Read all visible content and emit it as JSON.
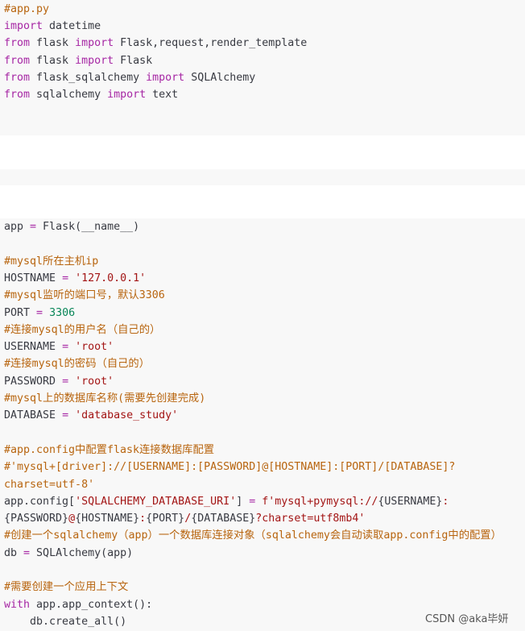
{
  "block1": {
    "lines": [
      {
        "segs": [
          {
            "t": "#app.py",
            "c": "cm"
          }
        ]
      },
      {
        "segs": [
          {
            "t": "import",
            "c": "kw"
          },
          {
            "t": " datetime",
            "c": ""
          }
        ]
      },
      {
        "segs": [
          {
            "t": "from",
            "c": "kw"
          },
          {
            "t": " flask ",
            "c": ""
          },
          {
            "t": "import",
            "c": "kw"
          },
          {
            "t": " Flask,request,render_template",
            "c": ""
          }
        ]
      },
      {
        "segs": [
          {
            "t": "from",
            "c": "kw"
          },
          {
            "t": " flask ",
            "c": ""
          },
          {
            "t": "import",
            "c": "kw"
          },
          {
            "t": " Flask",
            "c": ""
          }
        ]
      },
      {
        "segs": [
          {
            "t": "from",
            "c": "kw"
          },
          {
            "t": " flask_sqlalchemy ",
            "c": ""
          },
          {
            "t": "import",
            "c": "kw"
          },
          {
            "t": " SQLAlchemy",
            "c": ""
          }
        ]
      },
      {
        "segs": [
          {
            "t": "from",
            "c": "kw"
          },
          {
            "t": " sqlalchemy ",
            "c": ""
          },
          {
            "t": "import",
            "c": "kw"
          },
          {
            "t": " text",
            "c": ""
          }
        ]
      }
    ]
  },
  "block2": {
    "lines": [
      {
        "segs": [
          {
            "t": "app ",
            "c": ""
          },
          {
            "t": "=",
            "c": "op"
          },
          {
            "t": " Flask(__name__)",
            "c": ""
          }
        ]
      },
      {
        "segs": []
      },
      {
        "segs": [
          {
            "t": "#mysql所在主机ip",
            "c": "cm"
          }
        ]
      },
      {
        "segs": [
          {
            "t": "HOSTNAME ",
            "c": ""
          },
          {
            "t": "=",
            "c": "op"
          },
          {
            "t": " ",
            "c": ""
          },
          {
            "t": "'127.0.0.1'",
            "c": "st"
          }
        ]
      },
      {
        "segs": [
          {
            "t": "#mysql监听的端口号，默认3306",
            "c": "cm"
          }
        ]
      },
      {
        "segs": [
          {
            "t": "PORT ",
            "c": ""
          },
          {
            "t": "=",
            "c": "op"
          },
          {
            "t": " ",
            "c": ""
          },
          {
            "t": "3306",
            "c": "nm"
          }
        ]
      },
      {
        "segs": [
          {
            "t": "#连接mysql的用户名（自己的）",
            "c": "cm"
          }
        ]
      },
      {
        "segs": [
          {
            "t": "USERNAME ",
            "c": ""
          },
          {
            "t": "=",
            "c": "op"
          },
          {
            "t": " ",
            "c": ""
          },
          {
            "t": "'root'",
            "c": "st"
          }
        ]
      },
      {
        "segs": [
          {
            "t": "#连接mysql的密码（自己的）",
            "c": "cm"
          }
        ]
      },
      {
        "segs": [
          {
            "t": "PASSWORD ",
            "c": ""
          },
          {
            "t": "=",
            "c": "op"
          },
          {
            "t": " ",
            "c": ""
          },
          {
            "t": "'root'",
            "c": "st"
          }
        ]
      },
      {
        "segs": [
          {
            "t": "#mysql上的数据库名称(需要先创建完成)",
            "c": "cm"
          }
        ]
      },
      {
        "segs": [
          {
            "t": "DATABASE ",
            "c": ""
          },
          {
            "t": "=",
            "c": "op"
          },
          {
            "t": " ",
            "c": ""
          },
          {
            "t": "'database_study'",
            "c": "st"
          }
        ]
      },
      {
        "segs": []
      },
      {
        "segs": [
          {
            "t": "#app.config中配置flask连接数据库配置",
            "c": "cm"
          }
        ]
      },
      {
        "segs": [
          {
            "t": "#'mysql+[driver]://[USERNAME]:[PASSWORD]@[HOSTNAME]:[PORT]/[DATABASE]?",
            "c": "cm"
          }
        ]
      },
      {
        "segs": [
          {
            "t": "charset=utf-8'",
            "c": "cm"
          }
        ]
      },
      {
        "segs": [
          {
            "t": "app.config[",
            "c": ""
          },
          {
            "t": "'SQLALCHEMY_DATABASE_URI'",
            "c": "st"
          },
          {
            "t": "] ",
            "c": ""
          },
          {
            "t": "=",
            "c": "op"
          },
          {
            "t": " ",
            "c": ""
          },
          {
            "t": "f'mysql+pymysql://",
            "c": "fs"
          },
          {
            "t": "{USERNAME}",
            "c": ""
          },
          {
            "t": ":",
            "c": "fs"
          }
        ]
      },
      {
        "segs": [
          {
            "t": "{PASSWORD}",
            "c": ""
          },
          {
            "t": "@",
            "c": "fs"
          },
          {
            "t": "{HOSTNAME}",
            "c": ""
          },
          {
            "t": ":",
            "c": "fs"
          },
          {
            "t": "{PORT}",
            "c": ""
          },
          {
            "t": "/",
            "c": "fs"
          },
          {
            "t": "{DATABASE}",
            "c": ""
          },
          {
            "t": "?charset=utf8mb4'",
            "c": "fs"
          }
        ]
      },
      {
        "segs": [
          {
            "t": "#创建一个sqlalchemy（app）一个数据库连接对象（sqlalchemy会自动读取app.config中的配置）",
            "c": "cm"
          }
        ]
      },
      {
        "segs": [
          {
            "t": "db ",
            "c": ""
          },
          {
            "t": "=",
            "c": "op"
          },
          {
            "t": " SQLAlchemy(app)",
            "c": ""
          }
        ]
      },
      {
        "segs": []
      },
      {
        "segs": [
          {
            "t": "#需要创建一个应用上下文",
            "c": "cm"
          }
        ]
      },
      {
        "segs": [
          {
            "t": "with",
            "c": "kw"
          },
          {
            "t": " app.app_context():",
            "c": ""
          }
        ]
      },
      {
        "segs": [
          {
            "t": "    db.create_all()",
            "c": ""
          }
        ]
      }
    ]
  },
  "watermark": "CSDN @aka毕妍"
}
